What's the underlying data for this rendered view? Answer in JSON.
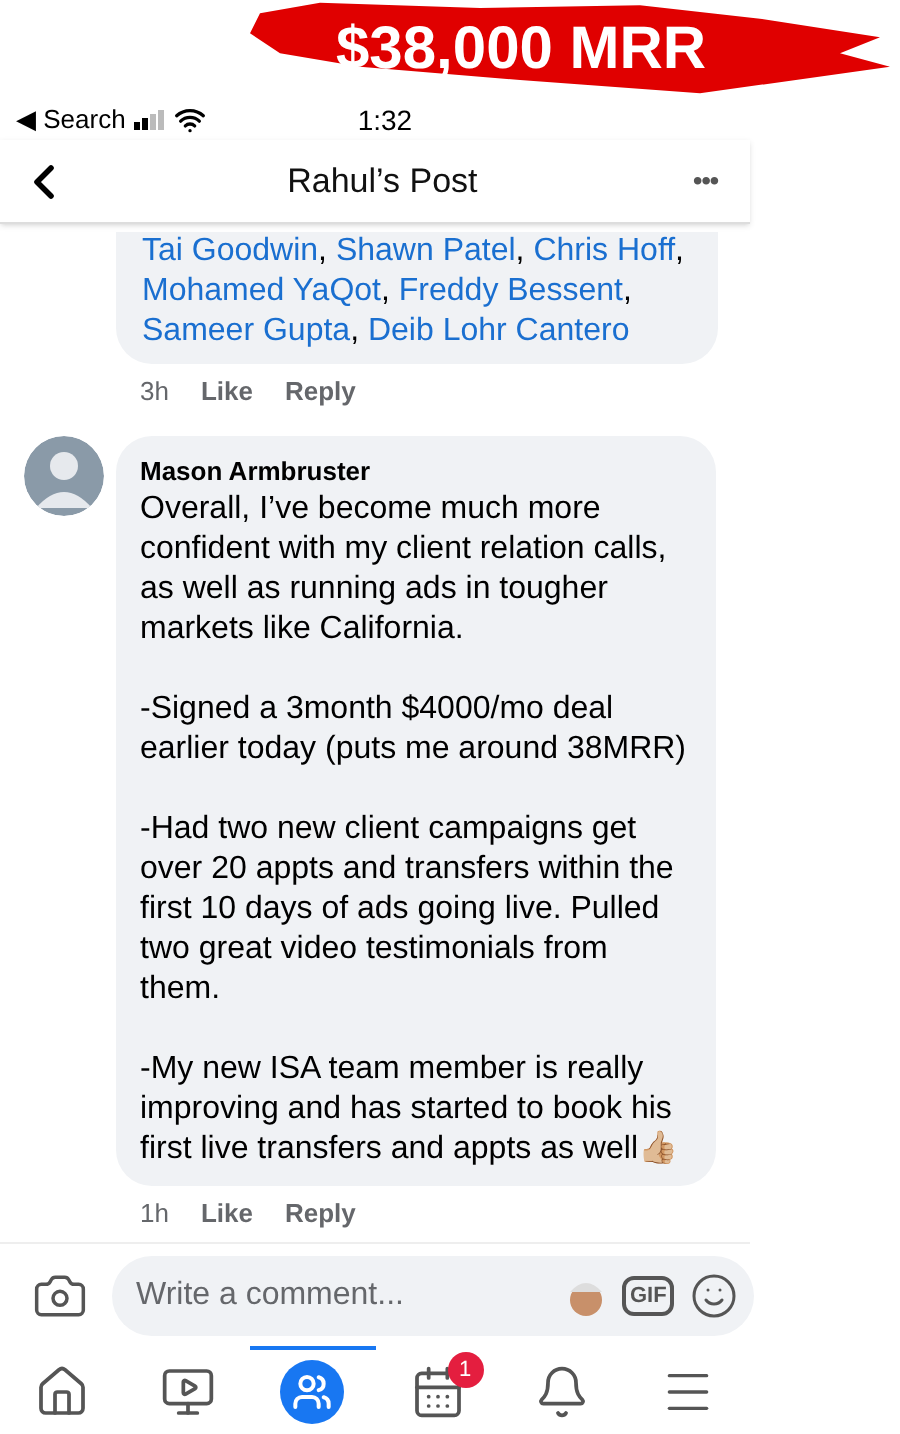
{
  "banner": {
    "text": "$38,000 MRR"
  },
  "status_bar": {
    "back_label": "◀ Search",
    "time": "1:32"
  },
  "header": {
    "title": "Rahul’s Post",
    "more": "•••"
  },
  "comments": [
    {
      "kind": "mentions",
      "mentions": [
        {
          "name": "Tai Goodwin",
          "after": ","
        },
        {
          "name": "Shawn Patel",
          "after": ","
        },
        {
          "name": "Chris Hoff",
          "after": ","
        },
        {
          "name": "Mohamed YaQot",
          "after": ","
        },
        {
          "name": "Freddy Bessent",
          "after": ","
        },
        {
          "name": "Sameer Gupta",
          "after": ","
        },
        {
          "name": "Deib Lohr Cantero"
        }
      ],
      "time": "3h",
      "like": "Like",
      "reply": "Reply"
    },
    {
      "kind": "text",
      "author": "Mason Armbruster",
      "paragraphs": [
        "Overall, I’ve become much more confident with my client relation calls, as well as running ads in tougher markets like California.",
        "-Signed a 3month $4000/mo deal earlier today (puts me around 38MRR)",
        "-Had two new client campaigns get over 20 appts and transfers within the first 10 days of ads going live. Pulled two great video testimonials from them.",
        "-My new ISA team member is really improving and has started to book his first live transfers and appts as well👍🏼"
      ],
      "time": "1h",
      "like": "Like",
      "reply": "Reply"
    }
  ],
  "composer": {
    "placeholder": "Write a comment...",
    "gif": "GIF"
  },
  "nav": [
    {
      "kind": "home",
      "selected": false
    },
    {
      "kind": "video",
      "selected": false
    },
    {
      "kind": "groups",
      "selected": true
    },
    {
      "kind": "events",
      "selected": false,
      "badge": "1"
    },
    {
      "kind": "bell",
      "selected": false
    },
    {
      "kind": "menu",
      "selected": false
    }
  ]
}
